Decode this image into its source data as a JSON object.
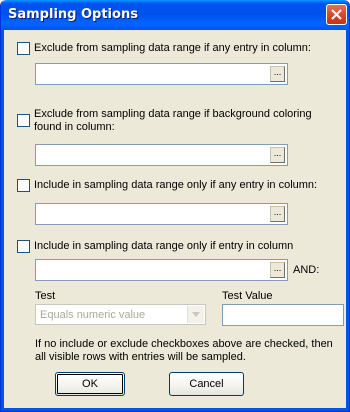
{
  "window": {
    "title": "Sampling Options",
    "close_icon": "close-icon"
  },
  "options": [
    {
      "label": "Exclude from sampling data range if any entry in column:",
      "checked": false,
      "field_value": "",
      "picker_label": "..."
    },
    {
      "label": "Exclude from sampling data range if background coloring found  in column:",
      "checked": false,
      "field_value": "",
      "picker_label": "..."
    },
    {
      "label": "Include in sampling data range only if any entry in column:",
      "checked": false,
      "field_value": "",
      "picker_label": "..."
    },
    {
      "label": "Include in sampling data range only if entry in column",
      "checked": false,
      "field_value": "",
      "picker_label": "...",
      "suffix": "AND:"
    }
  ],
  "test": {
    "label": "Test",
    "selected": "Equals numeric value",
    "disabled": true
  },
  "test_value": {
    "label": "Test Value",
    "value": ""
  },
  "note": "If no include or exclude checkboxes above are checked, then all visible rows with entries will be sampled.",
  "buttons": {
    "ok": "OK",
    "cancel": "Cancel"
  }
}
